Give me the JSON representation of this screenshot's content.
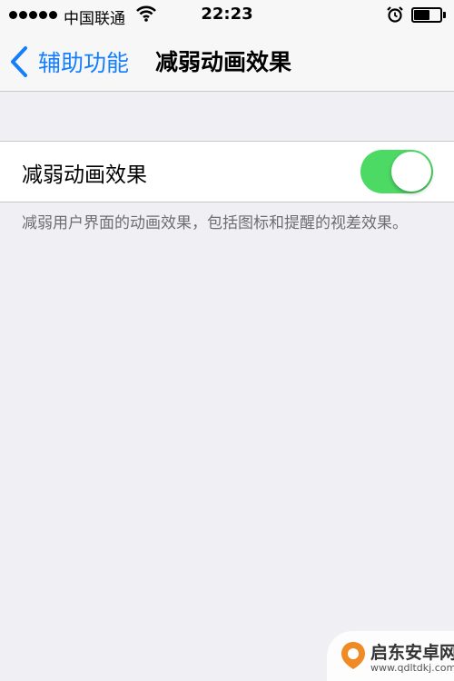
{
  "status_bar": {
    "carrier": "中国联通",
    "time": "22:23",
    "battery_level": 0.6,
    "icons": [
      "signal-dots-icon",
      "wifi-icon",
      "alarm-icon",
      "battery-icon"
    ]
  },
  "nav": {
    "back_label": "辅助功能",
    "title": "减弱动画效果",
    "accent_color": "#147efb"
  },
  "setting": {
    "label": "减弱动画效果",
    "toggle_on": true,
    "toggle_color": "#4cd964"
  },
  "footer_note": "减弱用户界面的动画效果，包括图标和提醒的视差效果。",
  "watermark": {
    "text": "启东安卓网",
    "url": "www.qdltdkj.com"
  }
}
